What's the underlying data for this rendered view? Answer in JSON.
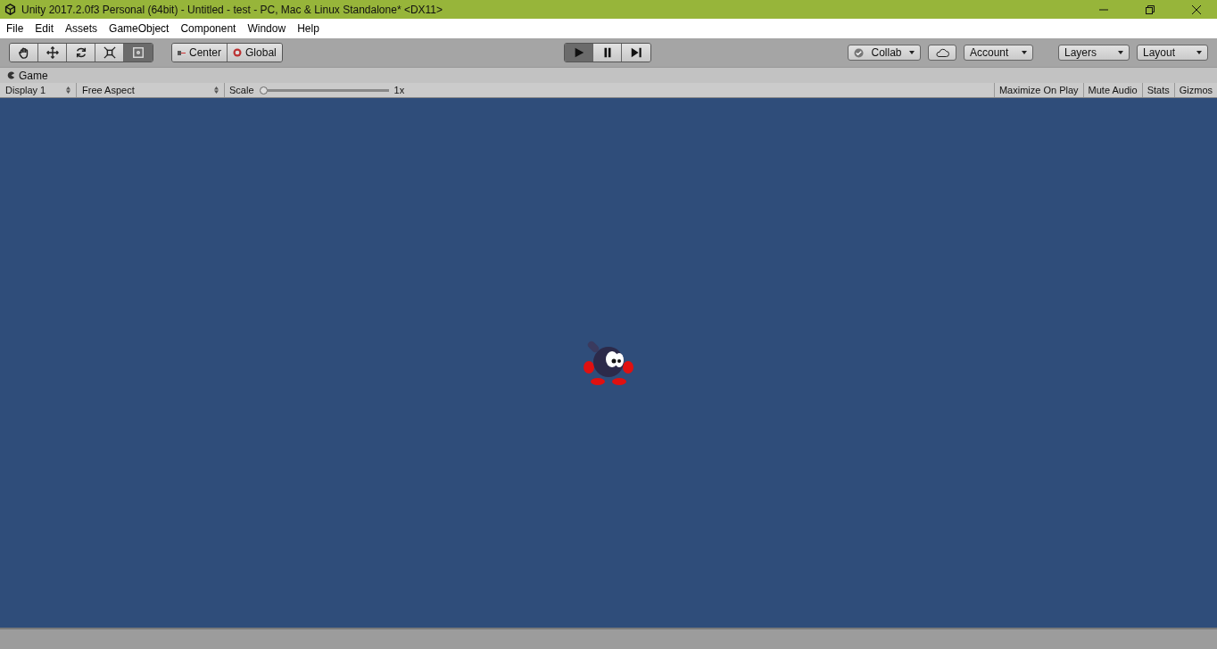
{
  "window": {
    "title": "Unity 2017.2.0f3 Personal (64bit) - Untitled - test - PC, Mac & Linux Standalone* <DX11>"
  },
  "menu": [
    "File",
    "Edit",
    "Assets",
    "GameObject",
    "Component",
    "Window",
    "Help"
  ],
  "tools": [
    {
      "kind": "hand",
      "selected": false
    },
    {
      "kind": "move",
      "selected": false
    },
    {
      "kind": "rotate",
      "selected": false
    },
    {
      "kind": "scale",
      "selected": false
    },
    {
      "kind": "rect",
      "selected": true
    }
  ],
  "pivot": [
    {
      "kind": "center",
      "label": "Center"
    },
    {
      "kind": "global",
      "label": "Global"
    }
  ],
  "playback": [
    {
      "kind": "play",
      "selected": true
    },
    {
      "kind": "pause",
      "selected": false
    },
    {
      "kind": "step",
      "selected": false
    }
  ],
  "right_buttons": [
    {
      "kind": "collab",
      "label": "Collab"
    },
    {
      "kind": "cloud"
    },
    {
      "kind": "account",
      "label": "Account"
    },
    {
      "kind": "layers",
      "label": "Layers"
    },
    {
      "kind": "layout",
      "label": "Layout"
    }
  ],
  "tab": {
    "label": "Game"
  },
  "game_toolbar": {
    "display": "Display 1",
    "aspect": "Free Aspect",
    "scale_label": "Scale",
    "scale": {
      "level": 0
    },
    "scale_reading": "1x",
    "toggles": [
      {
        "label": "Maximize On Play",
        "selected": false
      },
      {
        "label": "Mute Audio",
        "selected": false
      },
      {
        "label": "Stats",
        "selected": false
      },
      {
        "label": "Gizmos",
        "selected": false
      }
    ]
  }
}
